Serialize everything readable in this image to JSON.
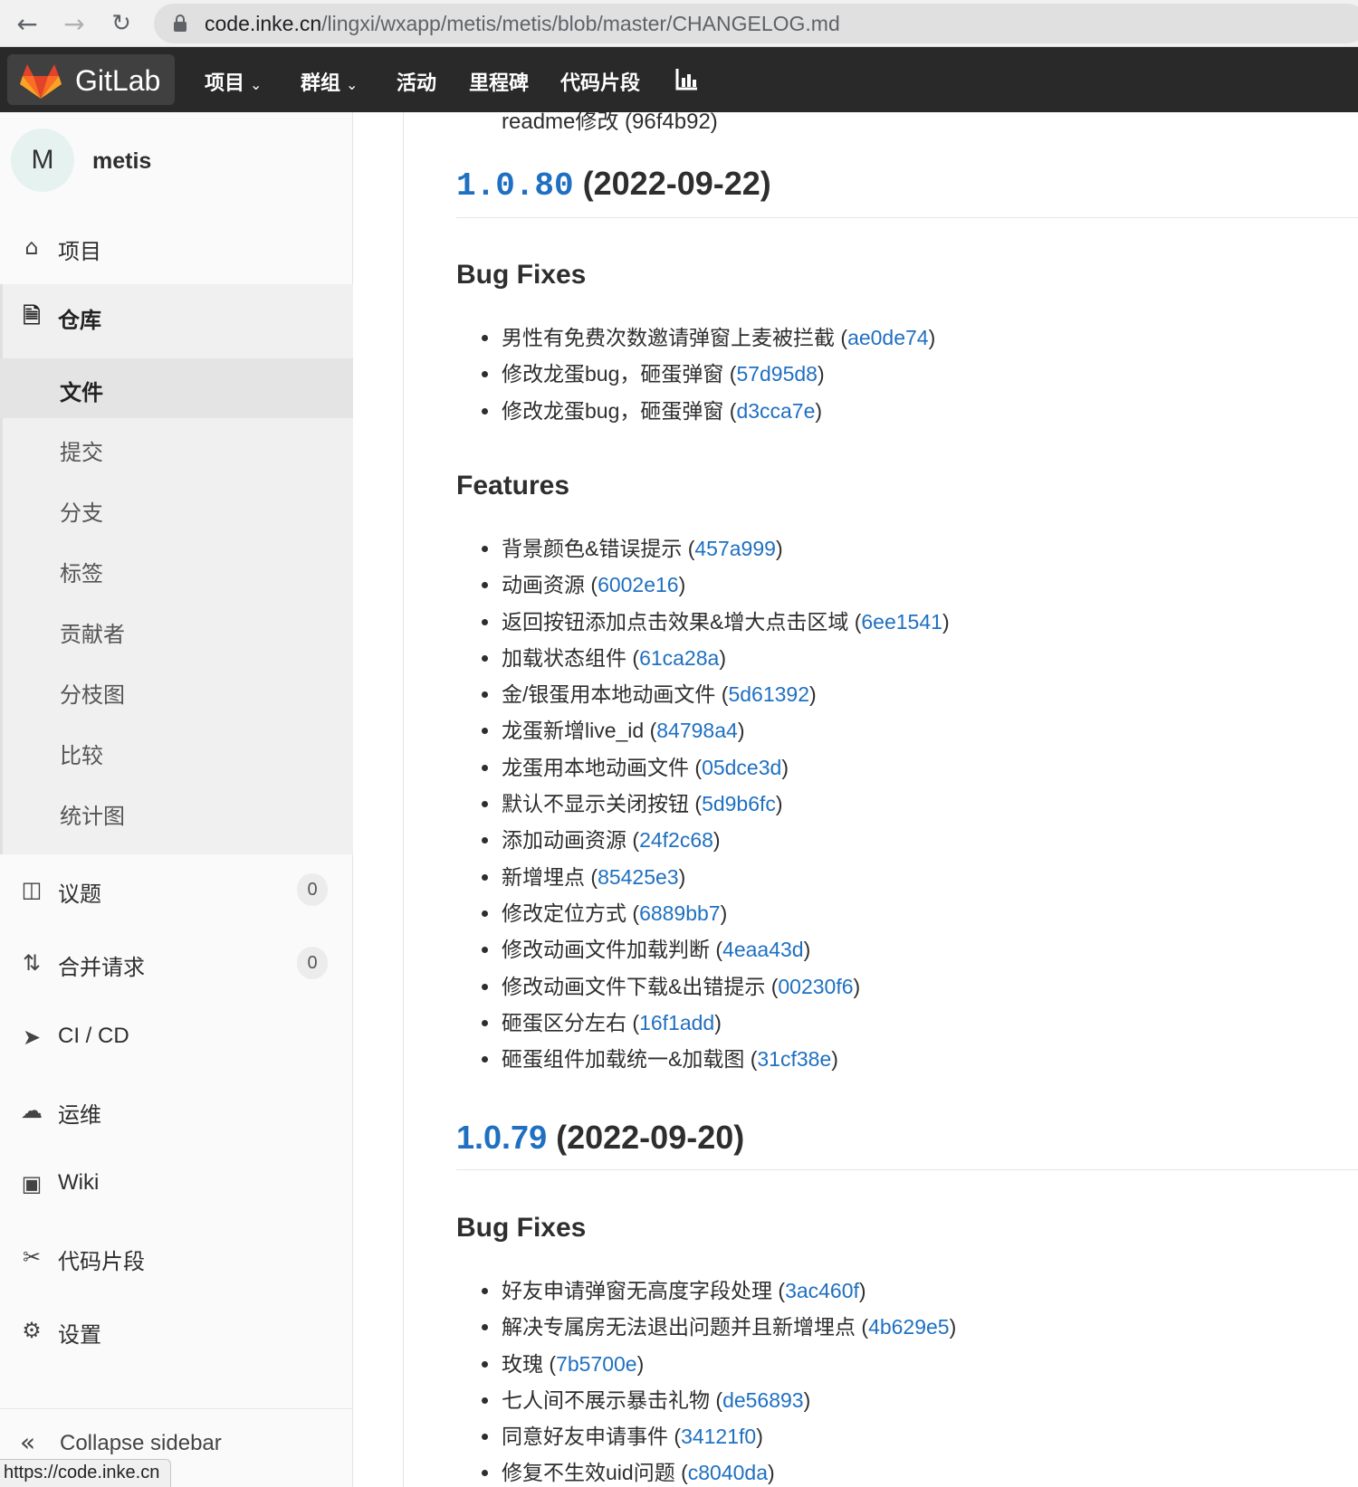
{
  "browser": {
    "url_host": "code.inke.cn",
    "url_path": "/lingxi/wxapp/metis/metis/blob/master/CHANGELOG.md"
  },
  "header": {
    "logo_text": "GitLab",
    "nav": [
      "项目",
      "群组",
      "活动",
      "里程碑",
      "代码片段"
    ]
  },
  "sidebar": {
    "avatar_letter": "M",
    "project_name": "metis",
    "project_label": "项目",
    "repo_label": "仓库",
    "repo_sub": [
      "文件",
      "提交",
      "分支",
      "标签",
      "贡献者",
      "分枝图",
      "比较",
      "统计图"
    ],
    "issues_label": "议题",
    "issues_count": "0",
    "mr_label": "合并请求",
    "mr_count": "0",
    "cicd_label": "CI / CD",
    "ops_label": "运维",
    "wiki_label": "Wiki",
    "snippets_label": "代码片段",
    "settings_label": "设置",
    "collapse_label": "Collapse sidebar"
  },
  "status_url": "https://code.inke.cn",
  "content": {
    "cut_line": "readme修改 (96f4b92)",
    "v1": {
      "version": "1.0.80",
      "date": "(2022-09-22)",
      "bugfix_title": "Bug Fixes",
      "bugfixes": [
        {
          "text": "男性有免费次数邀请弹窗上麦被拦截 (",
          "hash": "ae0de74",
          "close": ")"
        },
        {
          "text": "修改龙蛋bug，砸蛋弹窗 (",
          "hash": "57d95d8",
          "close": ")"
        },
        {
          "text": "修改龙蛋bug，砸蛋弹窗 (",
          "hash": "d3cca7e",
          "close": ")"
        }
      ],
      "features_title": "Features",
      "features": [
        {
          "text": "背景颜色&错误提示 (",
          "hash": "457a999",
          "close": ")"
        },
        {
          "text": "动画资源 (",
          "hash": "6002e16",
          "close": ")"
        },
        {
          "text": "返回按钮添加点击效果&增大点击区域 (",
          "hash": "6ee1541",
          "close": ")"
        },
        {
          "text": "加载状态组件 (",
          "hash": "61ca28a",
          "close": ")"
        },
        {
          "text": "金/银蛋用本地动画文件 (",
          "hash": "5d61392",
          "close": ")"
        },
        {
          "text": "龙蛋新增live_id (",
          "hash": "84798a4",
          "close": ")"
        },
        {
          "text": "龙蛋用本地动画文件 (",
          "hash": "05dce3d",
          "close": ")"
        },
        {
          "text": "默认不显示关闭按钮 (",
          "hash": "5d9b6fc",
          "close": ")"
        },
        {
          "text": "添加动画资源 (",
          "hash": "24f2c68",
          "close": ")"
        },
        {
          "text": "新增埋点 (",
          "hash": "85425e3",
          "close": ")"
        },
        {
          "text": "修改定位方式 (",
          "hash": "6889bb7",
          "close": ")"
        },
        {
          "text": "修改动画文件加载判断 (",
          "hash": "4eaa43d",
          "close": ")"
        },
        {
          "text": "修改动画文件下载&出错提示 (",
          "hash": "00230f6",
          "close": ")"
        },
        {
          "text": "砸蛋区分左右 (",
          "hash": "16f1add",
          "close": ")"
        },
        {
          "text": "砸蛋组件加载统一&加载图 (",
          "hash": "31cf38e",
          "close": ")"
        }
      ]
    },
    "v2": {
      "version": "1.0.79",
      "date": "(2022-09-20)",
      "bugfix_title": "Bug Fixes",
      "bugfixes": [
        {
          "text": "好友申请弹窗无高度字段处理 (",
          "hash": "3ac460f",
          "close": ")"
        },
        {
          "text": "解决专属房无法退出问题并且新增埋点 (",
          "hash": "4b629e5",
          "close": ")"
        },
        {
          "text": "玫瑰 (",
          "hash": "7b5700e",
          "close": ")"
        },
        {
          "text": "七人间不展示暴击礼物 (",
          "hash": "de56893",
          "close": ")"
        },
        {
          "text": "同意好友申请事件 (",
          "hash": "34121f0",
          "close": ")"
        },
        {
          "text": "修复不生效uid问题 (",
          "hash": "c8040da",
          "close": ")"
        }
      ]
    }
  }
}
